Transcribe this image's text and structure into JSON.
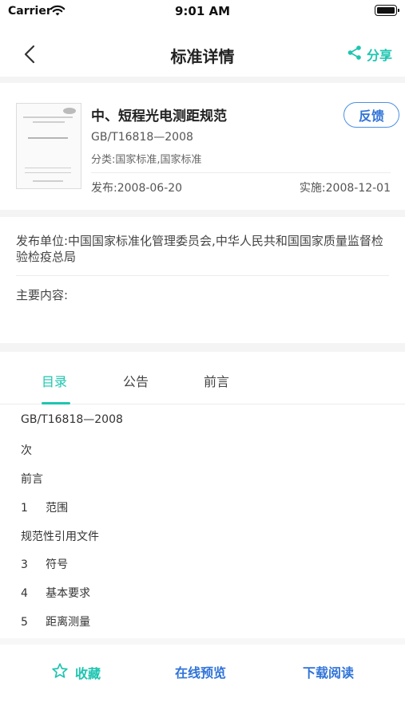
{
  "status_bar": {
    "carrier": "Carrier",
    "time": "9:01 AM"
  },
  "nav": {
    "title": "标准详情",
    "share_label": "分享"
  },
  "standard": {
    "title": "中、短程光电测距规范",
    "code": "GB/T16818—2008",
    "category": "分类:国家标准,国家标准",
    "feedback_label": "反馈",
    "publish_date": "发布:2008-06-20",
    "effective_date": "实施:2008-12-01"
  },
  "info": {
    "publisher": "发布单位:中国国家标准化管理委员会,中华人民共和国国家质量监督检验检疫总局",
    "main_content_label": "主要内容:"
  },
  "tabs": [
    {
      "label": "目录",
      "active": true
    },
    {
      "label": "公告",
      "active": false
    },
    {
      "label": "前言",
      "active": false
    }
  ],
  "toc": [
    "GB/T16818—2008",
    "次",
    "前言",
    "1     范围",
    "规范性引用文件",
    "3     符号",
    "4     基本要求",
    "5     距离测量"
  ],
  "actions": {
    "favorite_label": "收藏",
    "preview_label": "在线预览",
    "download_label": "下载阅读"
  },
  "colors": {
    "accent": "#1ec5b0",
    "link": "#2f73d8"
  },
  "icons": {
    "back": "chevron-left-icon",
    "share": "share-icon",
    "favorite": "star-outline-icon",
    "wifi": "wifi-icon",
    "battery": "battery-icon"
  }
}
